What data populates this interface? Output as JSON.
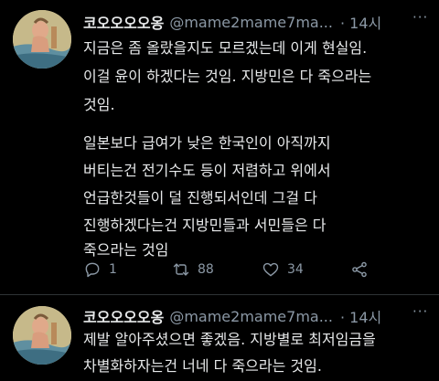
{
  "tweets": [
    {
      "name": "코오오오오옹",
      "handle": "@mame2mame7ma...",
      "time": "· 14시",
      "more": "···",
      "lines": [
        "지금은 좀 올랐을지도 모르겠는데 이게 현실임.",
        "이걸 윤이 하겠다는 것임. 지방민은 다 죽으라는",
        "것임.",
        "",
        "일본보다 급여가 낮은 한국인이 아직까지",
        "버티는건 전기수도 등이 저렴하고 위에서",
        "언급한것들이 덜 진행되서인데 그걸 다",
        "진행하겠다는건 지방민들과 서민들은 다",
        "죽으라는 것임"
      ],
      "actions": {
        "reply_count": "1",
        "retweet_count": "88",
        "like_count": "34"
      }
    },
    {
      "name": "코오오오오옹",
      "handle": "@mame2mame7ma...",
      "time": "· 14시",
      "more": "···",
      "lines": [
        "제발 알아주셨으면 좋겠음. 지방별로 최저임금을",
        "차별화하자는건 너네 다 죽으라는 것임."
      ]
    }
  ],
  "colors": {
    "background": "#000000",
    "text": "#e7e9ea",
    "secondary": "#8b98a5",
    "divider": "#2f3336"
  },
  "icons": {
    "reply": "reply-icon",
    "retweet": "retweet-icon",
    "like": "heart-icon",
    "share": "share-icon"
  }
}
